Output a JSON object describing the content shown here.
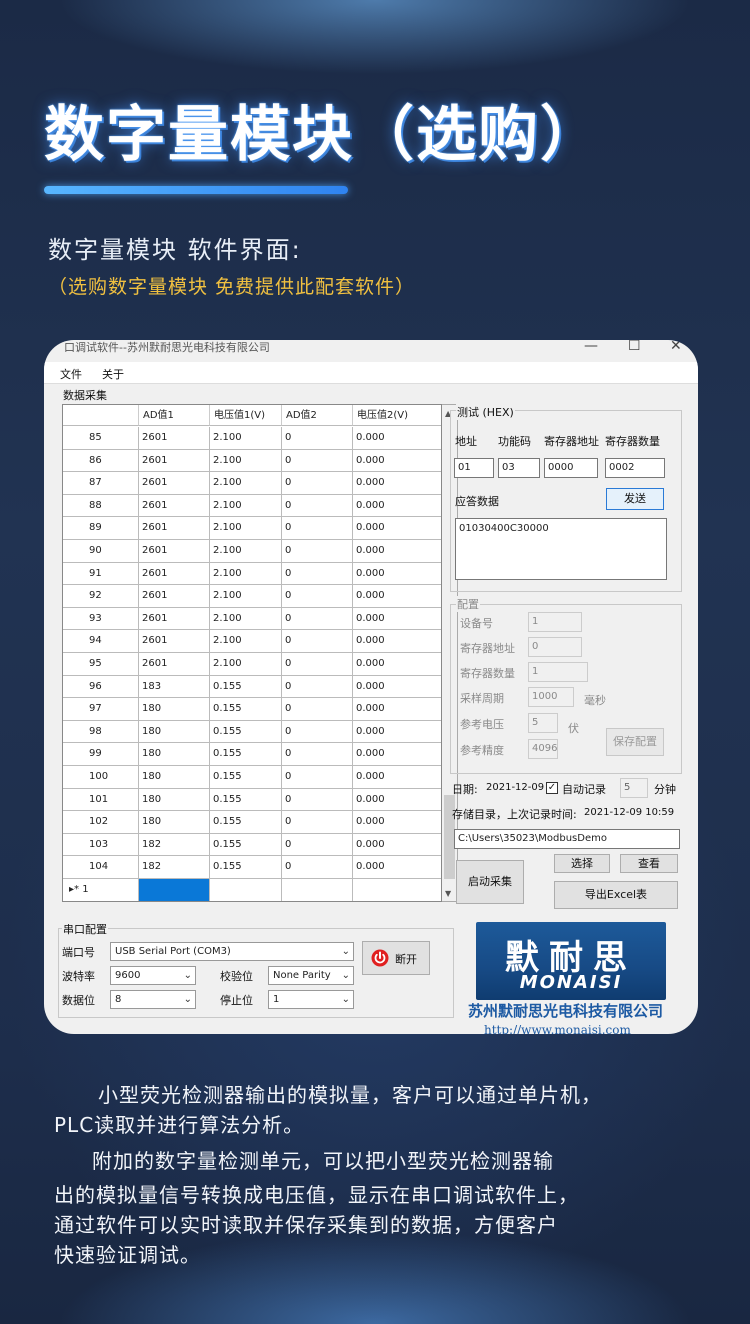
{
  "hero": {
    "headline": "数字量模块（选购）",
    "subtitle": "数字量模块 软件界面:",
    "note": "（选购数字量模块 免费提供此配套软件）"
  },
  "window": {
    "title": "口调试软件--苏州默耐思光电科技有限公司",
    "menu": [
      "文件",
      "关于"
    ]
  },
  "acquisition": {
    "group_label": "数据采集",
    "columns": [
      "AD值1",
      "电压值1(V)",
      "AD值2",
      "电压值2(V)"
    ],
    "rows": [
      [
        "85",
        "2601",
        "2.100",
        "0",
        "0.000"
      ],
      [
        "86",
        "2601",
        "2.100",
        "0",
        "0.000"
      ],
      [
        "87",
        "2601",
        "2.100",
        "0",
        "0.000"
      ],
      [
        "88",
        "2601",
        "2.100",
        "0",
        "0.000"
      ],
      [
        "89",
        "2601",
        "2.100",
        "0",
        "0.000"
      ],
      [
        "90",
        "2601",
        "2.100",
        "0",
        "0.000"
      ],
      [
        "91",
        "2601",
        "2.100",
        "0",
        "0.000"
      ],
      [
        "92",
        "2601",
        "2.100",
        "0",
        "0.000"
      ],
      [
        "93",
        "2601",
        "2.100",
        "0",
        "0.000"
      ],
      [
        "94",
        "2601",
        "2.100",
        "0",
        "0.000"
      ],
      [
        "95",
        "2601",
        "2.100",
        "0",
        "0.000"
      ],
      [
        "96",
        "183",
        "0.155",
        "0",
        "0.000"
      ],
      [
        "97",
        "180",
        "0.155",
        "0",
        "0.000"
      ],
      [
        "98",
        "180",
        "0.155",
        "0",
        "0.000"
      ],
      [
        "99",
        "180",
        "0.155",
        "0",
        "0.000"
      ],
      [
        "100",
        "180",
        "0.155",
        "0",
        "0.000"
      ],
      [
        "101",
        "180",
        "0.155",
        "0",
        "0.000"
      ],
      [
        "102",
        "180",
        "0.155",
        "0",
        "0.000"
      ],
      [
        "103",
        "182",
        "0.155",
        "0",
        "0.000"
      ],
      [
        "104",
        "182",
        "0.155",
        "0",
        "0.000"
      ]
    ],
    "new_row_marker": "▸* 1"
  },
  "test": {
    "group_label": "测试 (HEX)",
    "addr_label": "地址",
    "func_label": "功能码",
    "reg_addr_label": "寄存器地址",
    "reg_count_label": "寄存器数量",
    "addr": "01",
    "func": "03",
    "reg_addr": "0000",
    "reg_count": "0002",
    "response_label": "应答数据",
    "send_label": "发送",
    "response": "01030400C30000"
  },
  "config": {
    "group_label": "配置",
    "device_label": "设备号",
    "device": "1",
    "reg_addr_label": "寄存器地址",
    "reg_addr": "0",
    "reg_count_label": "寄存器数量",
    "reg_count": "1",
    "period_label": "采样周期",
    "period": "1000",
    "period_unit": "毫秒",
    "vref_label": "参考电压",
    "vref": "5",
    "vref_unit": "伏",
    "precision_label": "参考精度",
    "precision": "4096",
    "save_label": "保存配置"
  },
  "record": {
    "date_label": "日期:",
    "date": "2021-12-09",
    "check_mark": "✓",
    "auto_label": "自动记录",
    "minutes": "5",
    "minutes_unit": "分钟",
    "last_label": "存储目录，上次记录时间:",
    "last_time": "2021-12-09 10:59",
    "path": "C:\\Users\\35023\\ModbusDemo",
    "start_label": "启动采集",
    "select_label": "选择",
    "view_label": "查看",
    "export_label": "导出Excel表"
  },
  "serial": {
    "group_label": "串口配置",
    "port_label": "端口号",
    "port": "USB Serial Port (COM3)",
    "baud_label": "波特率",
    "baud": "9600",
    "parity_label": "校验位",
    "parity": "None Parity",
    "data_label": "数据位",
    "data": "8",
    "stop_label": "停止位",
    "stop": "1",
    "disconnect_label": "断开"
  },
  "brand": {
    "logo_cn": "默耐思",
    "logo_en": "MONAISI",
    "company": "苏州默耐思光电科技有限公司",
    "url": "http://www.monaisi.com"
  },
  "description": [
    "小型荧光检测器输出的模拟量，客户可以通过单片机，",
    "PLC读取并进行算法分析。",
    "附加的数字量检测单元，可以把小型荧光检测器输",
    "出的模拟量信号转换成电压值，显示在串口调试软件上，",
    "通过软件可以实时读取并保存采集到的数据，方便客户",
    "快速验证调试。"
  ],
  "colors": {
    "background": "#1d2c48",
    "accent_blue": "#3a8ff0",
    "note_gold": "#f0c040",
    "brand_blue": "#1d5aa3",
    "selection": "#0a78d7"
  }
}
